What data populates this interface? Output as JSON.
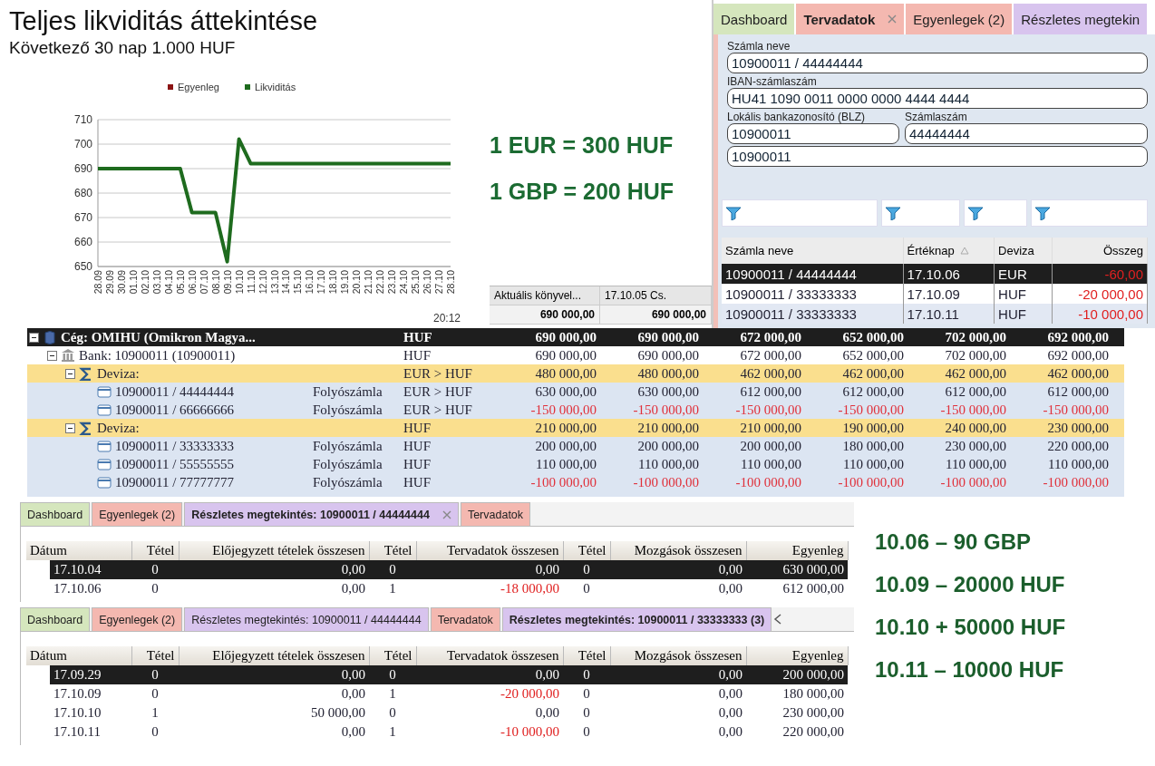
{
  "overview": {
    "title": "Teljes likviditás áttekintése",
    "subtitle": "Következő 30 nap 1.000 HUF",
    "time": "20:12",
    "chart_data": {
      "type": "line",
      "grid": true,
      "categories": [
        "28.09",
        "29.09",
        "30.09",
        "01.10",
        "02.10",
        "03.10",
        "04.10",
        "05.10",
        "06.10",
        "07.10",
        "08.10",
        "09.10",
        "10.10",
        "11.10",
        "12.10",
        "13.10",
        "14.10",
        "15.10",
        "16.10",
        "17.10",
        "18.10",
        "19.10",
        "20.10",
        "21.10",
        "22.10",
        "23.10",
        "24.10",
        "25.10",
        "26.10",
        "27.10",
        "28.10"
      ],
      "series": [
        {
          "name": "Egyenleg",
          "color": "#8b1414",
          "values": [
            null,
            null,
            null,
            null,
            null,
            null,
            null,
            null,
            null,
            null,
            null,
            null,
            null,
            null,
            null,
            null,
            null,
            null,
            null,
            null,
            null,
            null,
            null,
            null,
            null,
            null,
            null,
            null,
            null,
            null,
            null
          ]
        },
        {
          "name": "Likviditás",
          "color": "#1e6b1e",
          "values": [
            690,
            690,
            690,
            690,
            690,
            690,
            690,
            690,
            672,
            672,
            672,
            652,
            702,
            692,
            692,
            692,
            692,
            692,
            692,
            692,
            692,
            692,
            692,
            692,
            692,
            692,
            692,
            692,
            692,
            692,
            692
          ]
        }
      ],
      "ylim": [
        650,
        710
      ],
      "yticks": [
        650,
        660,
        670,
        680,
        690,
        700,
        710
      ]
    }
  },
  "rates": [
    "1 EUR = 300 HUF",
    "1 GBP = 200 HUF"
  ],
  "summary_grid": {
    "rows": [
      {
        "cells": [
          "Aktuális könyvel...",
          "17.10.05 Cs."
        ],
        "bold": false
      },
      {
        "cells": [
          "690 000,00",
          "690 000,00"
        ],
        "bold": true
      }
    ]
  },
  "plan_panel": {
    "tabs": [
      {
        "label": "Dashboard",
        "selected": false,
        "closable": false,
        "color": "#d5e6bd"
      },
      {
        "label": "Tervadatok",
        "selected": true,
        "closable": true,
        "color": "#f4b8b0"
      },
      {
        "label": "Egyenlegek (2)",
        "selected": false,
        "closable": false,
        "color": "#f4b8b0"
      },
      {
        "label": "Részletes megtekin",
        "selected": false,
        "closable": false,
        "color": "#d8c4ee"
      }
    ],
    "form_rows": [
      [
        {
          "label": "Számla neve",
          "value": "10900011 / 44444444"
        }
      ],
      [
        {
          "label": "IBAN-számlaszám",
          "value": "HU41 1090 0011 0000 0000 4444 4444"
        }
      ],
      [
        {
          "label": "Lokális bankazonosító (BLZ)",
          "value": "10900011"
        },
        {
          "label": "Számlaszám",
          "value": "44444444"
        }
      ],
      [
        {
          "value": "10900011"
        }
      ]
    ],
    "grid": {
      "columns": [
        {
          "label": "Számla neve",
          "sorted": false
        },
        {
          "label": "Értéknap",
          "sorted": true
        },
        {
          "label": "Deviza",
          "sorted": false
        },
        {
          "label": "Összeg",
          "sorted": false
        }
      ],
      "rows": [
        {
          "cells": [
            "10900011 / 44444444",
            "17.10.06",
            "EUR",
            "-60,00"
          ],
          "selected": true
        },
        {
          "cells": [
            "10900011 / 33333333",
            "17.10.09",
            "HUF",
            "-20 000,00"
          ],
          "selected": false
        },
        {
          "cells": [
            "10900011 / 33333333",
            "17.10.11",
            "HUF",
            "-10 000,00"
          ],
          "selected": false
        }
      ]
    }
  },
  "tree": {
    "nodes": [
      {
        "kind": "company",
        "label": "Cég: OMIHU (Omikron Magya...",
        "currency": "HUF",
        "values": [
          "690 000,00",
          "690 000,00",
          "672 000,00",
          "652 000,00",
          "702 000,00",
          "692 000,00"
        ],
        "negative": false,
        "expanded": true,
        "selected": true,
        "children": [
          {
            "kind": "bank",
            "label": "Bank: 10900011 (10900011)",
            "currency": "HUF",
            "values": [
              "690 000,00",
              "690 000,00",
              "672 000,00",
              "652 000,00",
              "702 000,00",
              "692 000,00"
            ],
            "negative": false,
            "expanded": true,
            "selected": false,
            "children": [
              {
                "kind": "group",
                "label": "Deviza:",
                "currency": "EUR > HUF",
                "values": [
                  "480 000,00",
                  "480 000,00",
                  "462 000,00",
                  "462 000,00",
                  "462 000,00",
                  "462 000,00"
                ],
                "negative": false,
                "expanded": true,
                "selected": false,
                "children": [
                  {
                    "kind": "account",
                    "label": "10900011 / 44444444",
                    "type": "Folyószámla",
                    "currency": "EUR > HUF",
                    "values": [
                      "630 000,00",
                      "630 000,00",
                      "612 000,00",
                      "612 000,00",
                      "612 000,00",
                      "612 000,00"
                    ],
                    "negative": false,
                    "selected": false
                  },
                  {
                    "kind": "account",
                    "label": "10900011 / 66666666",
                    "type": "Folyószámla",
                    "currency": "EUR > HUF",
                    "values": [
                      "-150 000,00",
                      "-150 000,00",
                      "-150 000,00",
                      "-150 000,00",
                      "-150 000,00",
                      "-150 000,00"
                    ],
                    "negative": true,
                    "selected": false
                  }
                ]
              },
              {
                "kind": "group",
                "label": "Deviza:",
                "currency": "HUF",
                "values": [
                  "210 000,00",
                  "210 000,00",
                  "210 000,00",
                  "190 000,00",
                  "240 000,00",
                  "230 000,00"
                ],
                "negative": false,
                "expanded": true,
                "selected": false,
                "children": [
                  {
                    "kind": "account",
                    "label": "10900011 / 33333333",
                    "type": "Folyószámla",
                    "currency": "HUF",
                    "values": [
                      "200 000,00",
                      "200 000,00",
                      "200 000,00",
                      "180 000,00",
                      "230 000,00",
                      "220 000,00"
                    ],
                    "negative": false,
                    "selected": false
                  },
                  {
                    "kind": "account",
                    "label": "10900011 / 55555555",
                    "type": "Folyószámla",
                    "currency": "HUF",
                    "values": [
                      "110 000,00",
                      "110 000,00",
                      "110 000,00",
                      "110 000,00",
                      "110 000,00",
                      "110 000,00"
                    ],
                    "negative": false,
                    "selected": false
                  },
                  {
                    "kind": "account",
                    "label": "10900011 / 77777777",
                    "type": "Folyószámla",
                    "currency": "HUF",
                    "values": [
                      "-100 000,00",
                      "-100 000,00",
                      "-100 000,00",
                      "-100 000,00",
                      "-100 000,00",
                      "-100 000,00"
                    ],
                    "negative": true,
                    "selected": false
                  }
                ]
              }
            ]
          }
        ]
      }
    ]
  },
  "details": [
    {
      "scroll_arrow": false,
      "tabs": [
        {
          "label": "Dashboard",
          "selected": false,
          "closable": false,
          "color": "#d5e6bd"
        },
        {
          "label": "Egyenlegek (2)",
          "selected": false,
          "closable": false,
          "color": "#f4b8b0"
        },
        {
          "label": "Részletes megtekintés: 10900011 / 44444444",
          "selected": true,
          "closable": true,
          "color": "#d8c4ee"
        },
        {
          "label": "Tervadatok",
          "selected": false,
          "closable": false,
          "color": "#f4b8b0"
        }
      ],
      "columns": [
        "Dátum",
        "Tétel",
        "Előjegyzett tételek összesen",
        "Tétel",
        "Tervadatok összesen",
        "Tétel",
        "Mozgások összesen",
        "Egyenleg"
      ],
      "rows": [
        {
          "cells": [
            "17.10.04",
            "0",
            "0,00",
            "0",
            "0,00",
            "0",
            "0,00",
            "630 000,00"
          ],
          "selected": true,
          "plan_negative": false
        },
        {
          "cells": [
            "17.10.06",
            "0",
            "0,00",
            "1",
            "-18 000,00",
            "0",
            "0,00",
            "612 000,00"
          ],
          "selected": false,
          "plan_negative": true
        }
      ]
    },
    {
      "scroll_arrow": true,
      "tabs": [
        {
          "label": "Dashboard",
          "selected": false,
          "closable": false,
          "color": "#d5e6bd"
        },
        {
          "label": "Egyenlegek (2)",
          "selected": false,
          "closable": false,
          "color": "#f4b8b0"
        },
        {
          "label": "Részletes megtekintés: 10900011 / 44444444",
          "selected": false,
          "closable": false,
          "color": "#d8c4ee"
        },
        {
          "label": "Tervadatok",
          "selected": false,
          "closable": false,
          "color": "#f4b8b0"
        },
        {
          "label": "Részletes megtekintés: 10900011 / 33333333 (3)",
          "selected": true,
          "closable": false,
          "color": "#d8c4ee"
        }
      ],
      "columns": [
        "Dátum",
        "Tétel",
        "Előjegyzett tételek összesen",
        "Tétel",
        "Tervadatok összesen",
        "Tétel",
        "Mozgások összesen",
        "Egyenleg"
      ],
      "rows": [
        {
          "cells": [
            "17.09.29",
            "0",
            "0,00",
            "0",
            "0,00",
            "0",
            "0,00",
            "200 000,00"
          ],
          "selected": true,
          "plan_negative": false
        },
        {
          "cells": [
            "17.10.09",
            "0",
            "0,00",
            "1",
            "-20 000,00",
            "0",
            "0,00",
            "180 000,00"
          ],
          "selected": false,
          "plan_negative": true
        },
        {
          "cells": [
            "17.10.10",
            "1",
            "50 000,00",
            "0",
            "0,00",
            "0",
            "0,00",
            "230 000,00"
          ],
          "selected": false,
          "plan_negative": false
        },
        {
          "cells": [
            "17.10.11",
            "0",
            "0,00",
            "1",
            "-10 000,00",
            "0",
            "0,00",
            "220 000,00"
          ],
          "selected": false,
          "plan_negative": true
        }
      ]
    }
  ],
  "notes": [
    "10.06 – 90 GBP",
    "10.09 – 20000 HUF",
    "10.10 + 50000 HUF",
    "10.11 – 10000 HUF"
  ]
}
